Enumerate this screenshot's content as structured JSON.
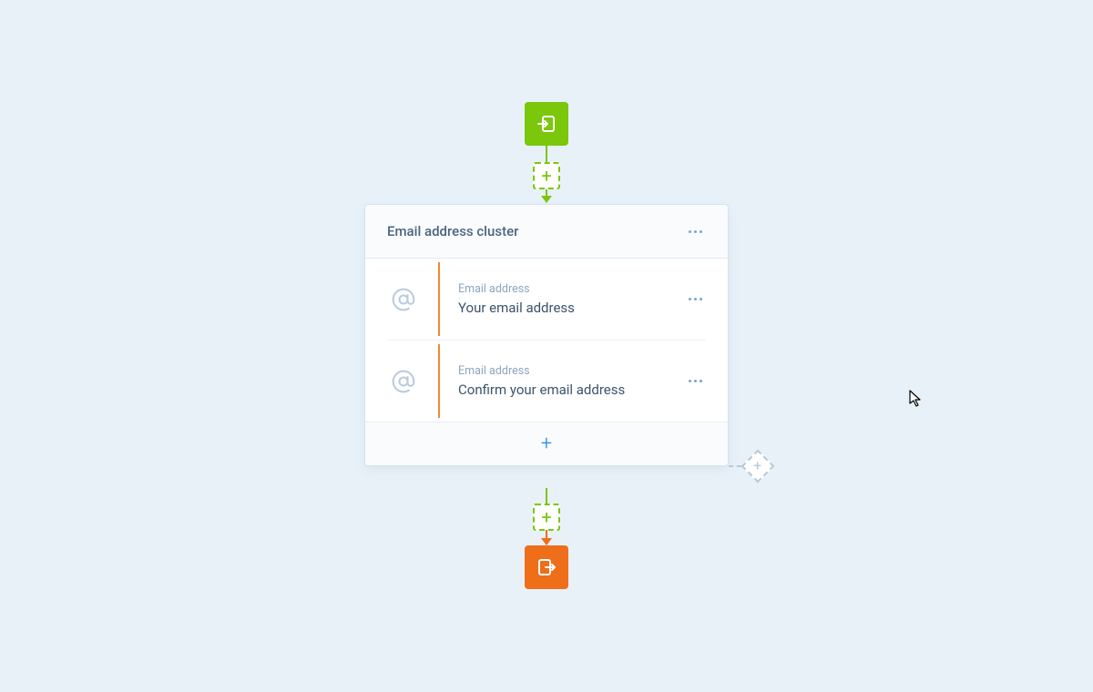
{
  "cluster": {
    "title": "Email address cluster",
    "fields": [
      {
        "type": "Email address",
        "label": "Your email address"
      },
      {
        "type": "Email address",
        "label": "Confirm your email address"
      }
    ]
  },
  "icons": {
    "start": "entry-icon",
    "end": "exit-icon",
    "at": "at-sign-icon",
    "plus": "+"
  },
  "colors": {
    "start": "#7ac70c",
    "end": "#ee6e1a",
    "accent": "#1e88e5",
    "field_bar": "#f08a2e"
  }
}
